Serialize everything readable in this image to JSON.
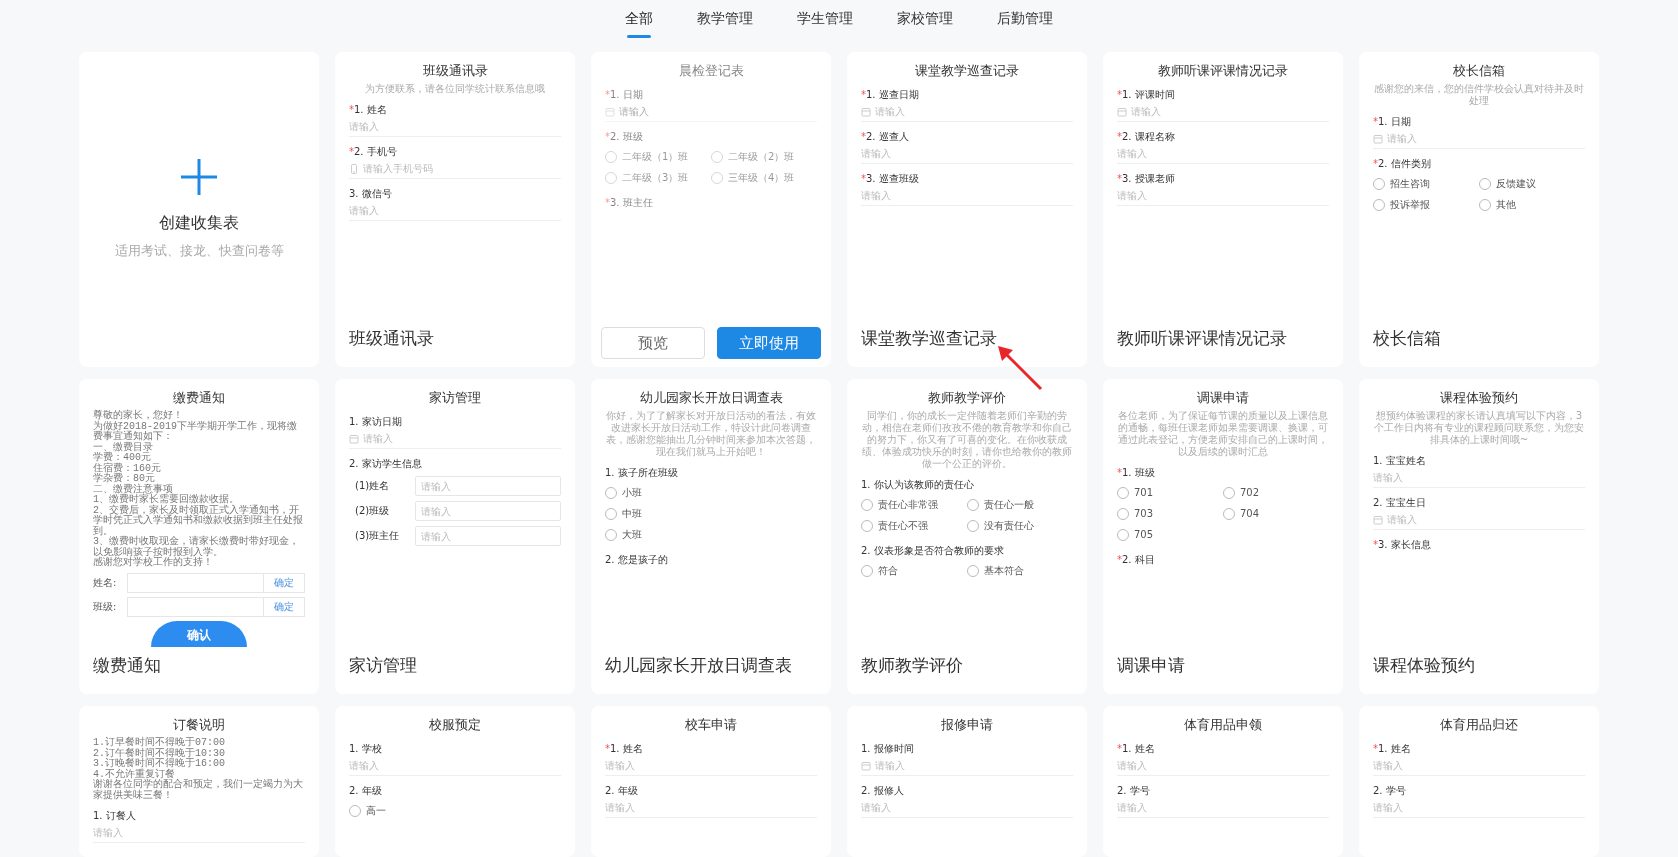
{
  "tabs": [
    {
      "label": "全部",
      "selected": true
    },
    {
      "label": "教学管理",
      "selected": false
    },
    {
      "label": "学生管理",
      "selected": false
    },
    {
      "label": "家校管理",
      "selected": false
    },
    {
      "label": "后勤管理",
      "selected": false
    }
  ],
  "create_card": {
    "title": "创建收集表",
    "subtitle": "适用考试、接龙、快查问卷等"
  },
  "templates": [
    {
      "title": "班级通讯录",
      "subtitle": "为方便联系，请各位同学统计联系信息哦",
      "hovered": false,
      "fields": [
        {
          "kind": "text",
          "mark": "*",
          "label": "1. 姓名",
          "placeholder": "请输入"
        },
        {
          "kind": "phone",
          "mark": "*",
          "label": "2. 手机号",
          "placeholder": "请输入手机号码"
        },
        {
          "kind": "text",
          "label": "3. 微信号",
          "placeholder": "请输入"
        }
      ],
      "caption": "班级通讯录"
    },
    {
      "title": "晨检登记表",
      "hovered": true,
      "fields": [
        {
          "kind": "date",
          "mark": "*",
          "label": "1. 日期",
          "placeholder": "请输入"
        },
        {
          "kind": "radio",
          "mark": "*",
          "label": "2. 班级",
          "options": [
            "二年级（1）班",
            "二年级（2）班",
            "二年级（3）班",
            "三年级（4）班"
          ]
        },
        {
          "kind": "label",
          "mark": "*",
          "label": "3. 班主任"
        }
      ],
      "actions": [
        {
          "label": "预览",
          "kind": "secondary"
        },
        {
          "label": "立即使用",
          "kind": "primary"
        }
      ]
    },
    {
      "title": "课堂教学巡查记录",
      "hovered": false,
      "annotation_arrow": true,
      "fields": [
        {
          "kind": "date",
          "mark": "*",
          "label": "1. 巡查日期",
          "placeholder": "请输入"
        },
        {
          "kind": "text",
          "mark": "*",
          "label": "2. 巡查人",
          "placeholder": "请输入"
        },
        {
          "kind": "text",
          "mark": "*",
          "label": "3. 巡查班级",
          "placeholder": "请输入"
        }
      ],
      "caption": "课堂教学巡查记录"
    },
    {
      "title": "教师听课评课情况记录",
      "hovered": false,
      "fields": [
        {
          "kind": "date",
          "mark": "*",
          "label": "1. 评课时间",
          "placeholder": "请输入"
        },
        {
          "kind": "text",
          "mark": "*",
          "label": "2. 课程名称",
          "placeholder": "请输入"
        },
        {
          "kind": "text",
          "mark": "*",
          "label": "3. 授课老师",
          "placeholder": "请输入"
        }
      ],
      "caption": "教师听课评课情况记录"
    },
    {
      "title": "校长信箱",
      "subtitle": "感谢您的来信，您的信件学校会认真对待并及时处理",
      "hovered": false,
      "fields": [
        {
          "kind": "date",
          "mark": "*",
          "label": "1. 日期",
          "placeholder": "请输入"
        },
        {
          "kind": "radio",
          "mark": "*",
          "label": "2. 信件类别",
          "options": [
            "招生咨询",
            "反馈建议",
            "投诉举报",
            "其他"
          ]
        }
      ],
      "caption": "校长信箱"
    },
    {
      "title": "缴费通知",
      "hovered": false,
      "fields": [
        {
          "kind": "notice",
          "lines": [
            "尊敬的家长，您好！",
            "为做好2018-2019下半学期开学工作，现将缴费事宜通知如下：",
            "一、缴费目录",
            "学费：400元",
            "住宿费：160元",
            "学杂费：80元",
            "二、缴费注意事项",
            "1、缴费时家长需要回缴款收据。",
            "2、交费后，家长及时领取正式入学通知书，开学时凭正式入学通知书和缴款收据到班主任处报到。",
            "3、缴费时收取现金，请家长缴费时带好现金，以免影响孩子按时报到入学。",
            "感谢您对学校工作的支持！"
          ]
        },
        {
          "kind": "inline",
          "label": "姓名:",
          "button": "确定"
        },
        {
          "kind": "inline",
          "label": "班级:",
          "button": "确定"
        },
        {
          "kind": "submit",
          "label": "确认"
        }
      ],
      "caption": "缴费通知"
    },
    {
      "title": "家访管理",
      "hovered": false,
      "fields": [
        {
          "kind": "date",
          "label": "1. 家访日期",
          "placeholder": "请输入"
        },
        {
          "kind": "group",
          "label": "2. 家访学生信息",
          "items": [
            {
              "label": "(1)姓名",
              "placeholder": "请输入"
            },
            {
              "label": "(2)班级",
              "placeholder": "请输入"
            },
            {
              "label": "(3)班主任",
              "placeholder": "请输入"
            }
          ]
        }
      ],
      "caption": "家访管理"
    },
    {
      "title": "幼儿园家长开放日调查表",
      "subtitle": "你好，为了了解家长对开放日活动的看法，有效改进家长开放日活动工作，特设计此问卷调查表，感谢您能抽出几分钟时间来参加本次答题，现在我们就马上开始吧！",
      "hovered": false,
      "fields": [
        {
          "kind": "radio-list",
          "label": "1. 孩子所在班级",
          "options": [
            "小班",
            "中班",
            "大班"
          ]
        },
        {
          "kind": "label",
          "label": "2. 您是孩子的"
        }
      ],
      "caption": "幼儿园家长开放日调查表"
    },
    {
      "title": "教师教学评价",
      "subtitle": "同学们，你的成长一定伴随着老师们辛勤的劳动，相信在老师们孜孜不倦的教育教学和你自己的努力下，你又有了可喜的变化。在你收获成绩、体验成功快乐的时刻，请你也给教你的教师做一个公正的评价。",
      "hovered": false,
      "fields": [
        {
          "kind": "radio",
          "label": "1. 你认为该教师的责任心",
          "options": [
            "责任心非常强",
            "责任心一般",
            "责任心不强",
            "没有责任心"
          ]
        },
        {
          "kind": "radio",
          "label": "2. 仪表形象是否符合教师的要求",
          "options": [
            "符合",
            "基本符合"
          ]
        }
      ],
      "caption": "教师教学评价"
    },
    {
      "title": "调课申请",
      "subtitle": "各位老师，为了保证每节课的质量以及上课信息的通畅，每班任课老师如果需要调课、换课，可通过此表登记，方便老师安排自己的上课时间，以及后续的课时汇总",
      "hovered": false,
      "fields": [
        {
          "kind": "radio",
          "mark": "*",
          "label": "1. 班级",
          "options": [
            "701",
            "702",
            "703",
            "704",
            "705"
          ]
        },
        {
          "kind": "label",
          "mark": "*",
          "label": "2. 科目"
        }
      ],
      "caption": "调课申请"
    },
    {
      "title": "课程体验预约",
      "subtitle": "想预约体验课程的家长请认真填写以下内容，3个工作日内将有专业的课程顾问联系您，为您安排具体的上课时间哦~",
      "hovered": false,
      "fields": [
        {
          "kind": "text",
          "label": "1. 宝宝姓名",
          "placeholder": "请输入"
        },
        {
          "kind": "date",
          "label": "2. 宝宝生日",
          "placeholder": "请输入"
        },
        {
          "kind": "label",
          "mark": "*",
          "label": "3. 家长信息"
        }
      ],
      "caption": "课程体验预约"
    },
    {
      "title": "订餐说明",
      "hovered": false,
      "fields": [
        {
          "kind": "notice",
          "lines": [
            "1.订早餐时间不得晚于07:00",
            "2.订午餐时间不得晚于10:30",
            "3.订晚餐时间不得晚于16:00",
            "4.不允许重复订餐",
            "谢谢各位同学的配合和预定，我们一定竭力为大家提供美味三餐！"
          ]
        },
        {
          "kind": "text",
          "label": "1. 订餐人",
          "placeholder": "请输入"
        }
      ]
    },
    {
      "title": "校服预定",
      "hovered": false,
      "fields": [
        {
          "kind": "text",
          "label": "1. 学校",
          "placeholder": "请输入"
        },
        {
          "kind": "radio",
          "label": "2. 年级",
          "options": [
            "高一"
          ]
        }
      ]
    },
    {
      "title": "校车申请",
      "hovered": false,
      "fields": [
        {
          "kind": "text",
          "mark": "*",
          "label": "1. 姓名",
          "placeholder": "请输入"
        },
        {
          "kind": "text",
          "label": "2. 年级",
          "placeholder": "请输入"
        }
      ]
    },
    {
      "title": "报修申请",
      "hovered": false,
      "fields": [
        {
          "kind": "date",
          "label": "1. 报修时间",
          "placeholder": "请输入"
        },
        {
          "kind": "text",
          "label": "2. 报修人",
          "placeholder": "请输入"
        }
      ]
    },
    {
      "title": "体育用品申领",
      "hovered": false,
      "fields": [
        {
          "kind": "text",
          "mark": "*",
          "label": "1. 姓名",
          "placeholder": "请输入"
        },
        {
          "kind": "text",
          "label": "2. 学号",
          "placeholder": "请输入"
        }
      ]
    },
    {
      "title": "体育用品归还",
      "hovered": false,
      "fields": [
        {
          "kind": "text",
          "mark": "*",
          "label": "1. 姓名",
          "placeholder": "请输入"
        },
        {
          "kind": "text",
          "label": "2. 学号",
          "placeholder": "请输入"
        }
      ]
    }
  ]
}
